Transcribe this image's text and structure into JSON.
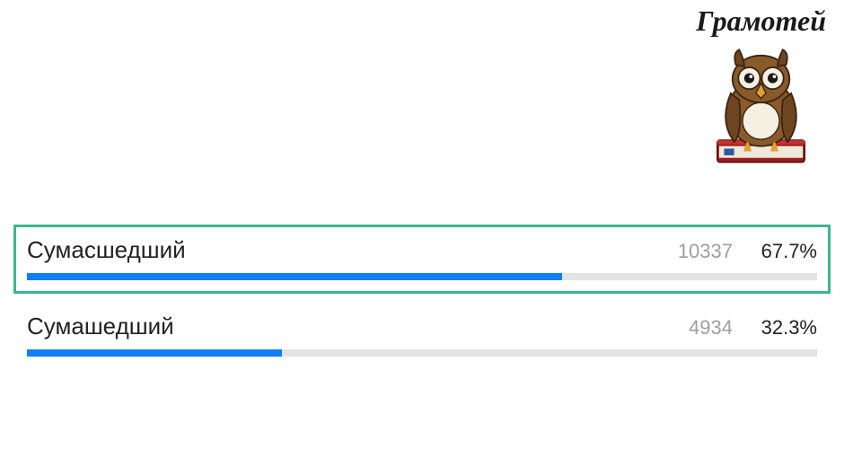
{
  "logo": {
    "title": "Грамотей"
  },
  "options": [
    {
      "label": "Сумасшедший",
      "count": "10337",
      "percent": "67.7%",
      "fill": 67.7,
      "correct": true
    },
    {
      "label": "Сумашедший",
      "count": "4934",
      "percent": "32.3%",
      "fill": 32.3,
      "correct": false
    }
  ],
  "chart_data": {
    "type": "bar",
    "title": "Грамотей",
    "categories": [
      "Сумасшедший",
      "Сумашедший"
    ],
    "series": [
      {
        "name": "votes",
        "values": [
          10337,
          4934
        ]
      },
      {
        "name": "percent",
        "values": [
          67.7,
          32.3
        ]
      }
    ],
    "xlabel": "",
    "ylabel": "",
    "ylim": [
      0,
      100
    ]
  }
}
